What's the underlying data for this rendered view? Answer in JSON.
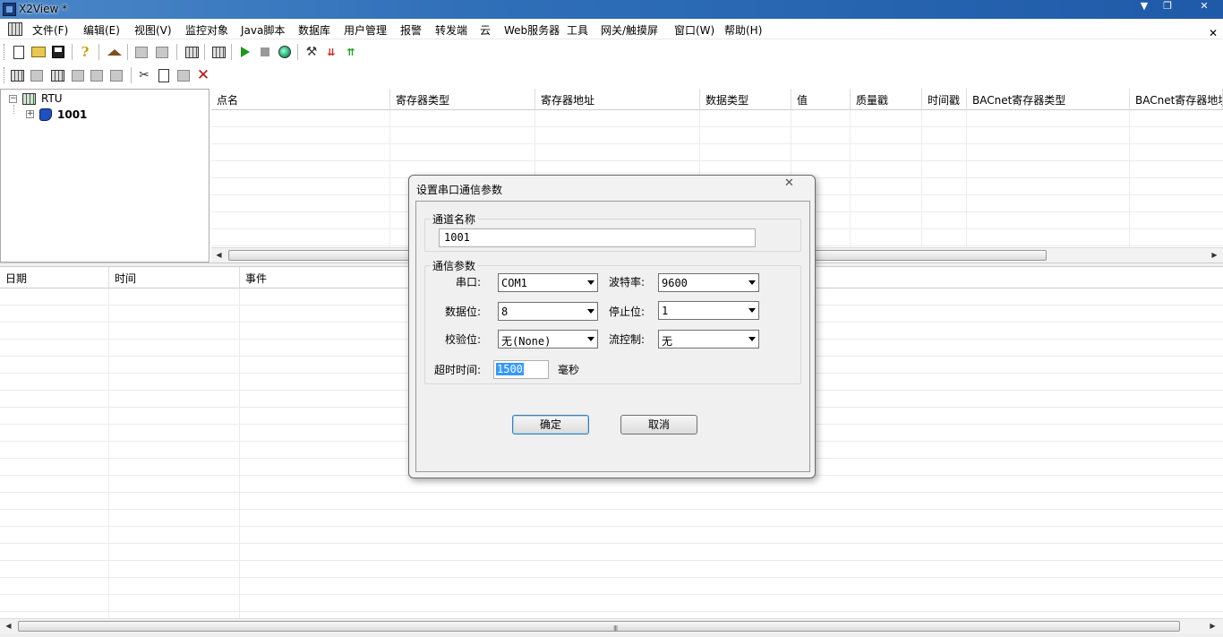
{
  "window": {
    "title": "X2View *",
    "min": "▼",
    "max": "❐",
    "close": "✕"
  },
  "menu": {
    "items": [
      "文件(F)",
      "编辑(E)",
      "视图(V)",
      "监控对象",
      "Java脚本",
      "数据库",
      "用户管理",
      "报警",
      "转发端",
      "云",
      "Web服务器",
      "工具",
      "网关/触摸屏",
      "窗口(W)",
      "帮助(H)"
    ],
    "mdi_close": "✕"
  },
  "tree": {
    "root": "RTU",
    "child": "1001",
    "root_expander": "−",
    "child_expander": "+"
  },
  "points_table": {
    "columns": [
      "点名",
      "寄存器类型",
      "寄存器地址",
      "数据类型",
      "值",
      "质量戳",
      "时间戳",
      "BACnet寄存器类型",
      "BACnet寄存器地址"
    ]
  },
  "events_table": {
    "columns": [
      "日期",
      "时间",
      "事件"
    ]
  },
  "dialog": {
    "title": "设置串口通信参数",
    "close": "✕",
    "channel_group": "通道名称",
    "channel_name": "1001",
    "comm_group": "通信参数",
    "port_label": "串口:",
    "port_value": "COM1",
    "baud_label": "波特率:",
    "baud_value": "9600",
    "databits_label": "数据位:",
    "databits_value": "8",
    "stopbits_label": "停止位:",
    "stopbits_value": "1",
    "parity_label": "校验位:",
    "parity_value": "无(None)",
    "flow_label": "流控制:",
    "flow_value": "无",
    "timeout_label": "超时时间:",
    "timeout_value": "1500",
    "timeout_unit": "毫秒",
    "ok": "确定",
    "cancel": "取消"
  },
  "scroll": {
    "left": "◀",
    "right": "▶",
    "grip": "III"
  }
}
